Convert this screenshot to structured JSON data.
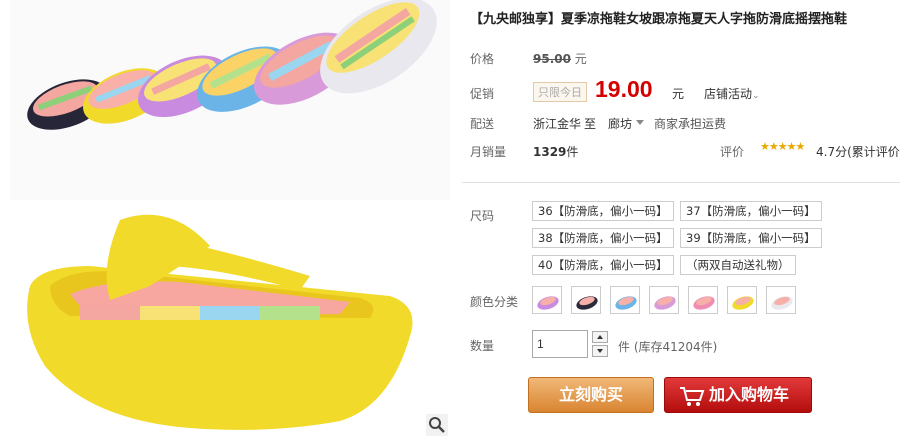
{
  "product": {
    "title": "【九央邮独享】夏季凉拖鞋女坡跟凉拖夏天人字拖防滑底摇摆拖鞋"
  },
  "price": {
    "label": "价格",
    "original": "95.00",
    "currency_unit": "元"
  },
  "promo": {
    "label": "促销",
    "tag": "只限今日",
    "price": "19.00",
    "currency_unit": "元",
    "shop_activity": "店铺活动"
  },
  "shipping": {
    "label": "配送",
    "from": "浙江金华",
    "to_word": "至",
    "to_city": "廊坊",
    "note": "商家承担运费"
  },
  "sales": {
    "label": "月销量",
    "count": "1329",
    "unit": "件",
    "rating_label": "评价",
    "stars": "★★★★★",
    "rating": "4.7分(累计评价"
  },
  "size": {
    "label": "尺码",
    "options": [
      "36【防滑底，偏小一码】",
      "37【防滑底，偏小一码】",
      "38【防滑底，偏小一码】",
      "39【防滑底，偏小一码】",
      "40【防滑底，偏小一码】",
      "（两双自动送礼物）"
    ]
  },
  "color": {
    "label": "颜色分类",
    "swatches": [
      {
        "icon": "flip-flop-purple",
        "color": "#c88be0"
      },
      {
        "icon": "flip-flop-black",
        "color": "#2a2a3a"
      },
      {
        "icon": "flip-flop-blue",
        "color": "#6ab4e8"
      },
      {
        "icon": "flip-flop-pink-purple",
        "color": "#d89ad8"
      },
      {
        "icon": "flip-flop-pink",
        "color": "#f08cb4"
      },
      {
        "icon": "flip-flop-yellow",
        "color": "#f2da2a"
      },
      {
        "icon": "flip-flop-white",
        "color": "#e8e8ee"
      }
    ]
  },
  "quantity": {
    "label": "数量",
    "value": "1",
    "stock": "件 (库存41204件)"
  },
  "actions": {
    "buy_now": "立刻购买",
    "add_to_cart": "加入购物车"
  },
  "colors": {
    "price_red": "#d40000",
    "buy_orange": "#d98530",
    "cart_red": "#c01515",
    "star_gold": "#e8a800"
  }
}
